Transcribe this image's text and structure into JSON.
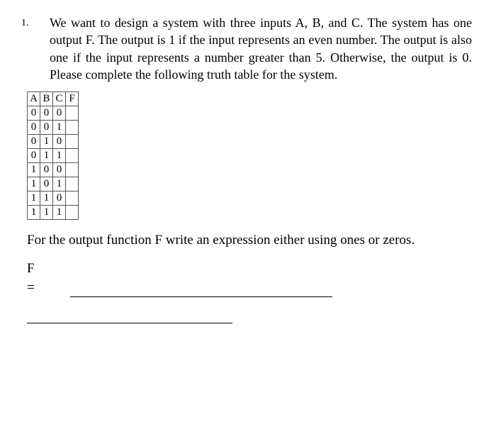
{
  "problem": {
    "number": "1.",
    "text": "We want to design a system with three inputs A, B, and C. The system has one output F. The output is 1 if the input represents an even number. The output is also one if the input represents a number greater than 5. Otherwise, the output is 0. Please complete the following truth table for the system."
  },
  "truth_table": {
    "headers": [
      "A",
      "B",
      "C",
      "F"
    ],
    "rows": [
      [
        "0",
        "0",
        "0",
        ""
      ],
      [
        "0",
        "0",
        "1",
        ""
      ],
      [
        "0",
        "1",
        "0",
        ""
      ],
      [
        "0",
        "1",
        "1",
        ""
      ],
      [
        "1",
        "0",
        "0",
        ""
      ],
      [
        "1",
        "0",
        "1",
        ""
      ],
      [
        "1",
        "1",
        "0",
        ""
      ],
      [
        "1",
        "1",
        "1",
        ""
      ]
    ]
  },
  "prompt2": "For the output function F write an expression either using ones or zeros.",
  "answer": {
    "label": "F",
    "eq": "="
  }
}
